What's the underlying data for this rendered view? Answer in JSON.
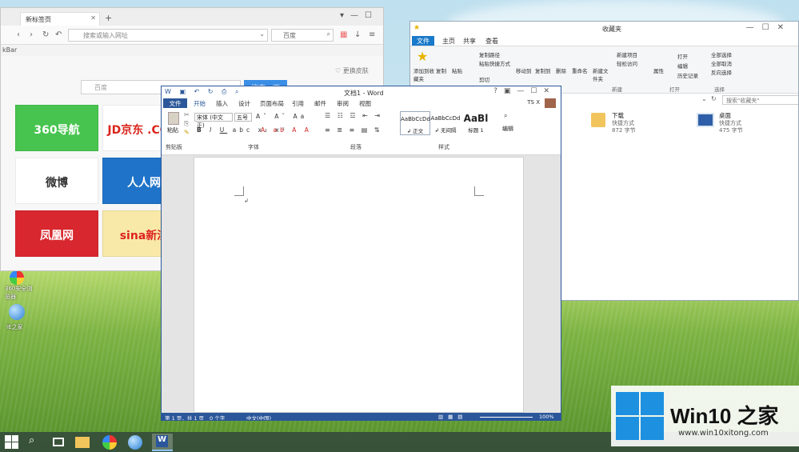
{
  "browser": {
    "tab_title": "新标签页",
    "url_placeholder": "搜索或输入网址",
    "search_engine": "百度",
    "bookmark_label": "kBar",
    "change_skin": "更换皮肤",
    "search_input": "百度",
    "search_button": "搜索一下",
    "tiles": [
      {
        "label": "360导航",
        "color": "#47c44f"
      },
      {
        "label": "JD京东 .COM",
        "color": "#ffffff"
      },
      {
        "label": "微博",
        "color": "#ffffff"
      },
      {
        "label": "人人网",
        "color": "#1f73c8"
      },
      {
        "label": "凤凰网",
        "color": "#d8272e"
      },
      {
        "label": "sina新浪",
        "color": "#f8e9a8"
      }
    ]
  },
  "explorer": {
    "title": "收藏夹",
    "tabs": [
      "文件",
      "主页",
      "共享",
      "查看"
    ],
    "ribbon": {
      "pin": "添加到收藏夹",
      "copy": "复制",
      "paste": "粘贴",
      "copy_path": "复制路径",
      "paste_shortcut": "粘贴快捷方式",
      "cut": "剪切",
      "move_to": "移动到",
      "copy_to": "复制到",
      "delete": "删除",
      "rename": "重命名",
      "new_folder": "新建文件夹",
      "new_item": "新建项目",
      "easy_access": "轻松访问",
      "properties": "属性",
      "open": "打开",
      "edit": "编辑",
      "history": "历史记录",
      "select_all": "全部选择",
      "select_none": "全部取消",
      "invert": "反向选择",
      "group_new": "新建",
      "group_open": "打开",
      "group_select": "选择"
    },
    "search_placeholder": "搜索\"收藏夹\"",
    "items": [
      {
        "name": "下载",
        "type": "快捷方式",
        "size": "872 字节"
      },
      {
        "name": "桌面",
        "type": "快捷方式",
        "size": "475 字节"
      }
    ]
  },
  "word": {
    "title": "文档1 - Word",
    "tabs": [
      "文件",
      "开始",
      "插入",
      "设计",
      "页面布局",
      "引用",
      "邮件",
      "审阅",
      "视图"
    ],
    "user": "TS X",
    "font_name": "宋体 (中文正)",
    "font_size": "五号",
    "groups": {
      "clipboard": "剪贴板",
      "font": "字体",
      "paragraph": "段落",
      "styles": "样式",
      "editing": "编辑"
    },
    "paste_label": "粘贴",
    "styles": [
      {
        "sample": "AaBbCcDd",
        "name": "↲ 正文"
      },
      {
        "sample": "AaBbCcDd",
        "name": "↲ 无间隔"
      },
      {
        "sample": "AaBl",
        "name": "标题 1"
      }
    ],
    "status": {
      "page": "第 1 页，共 1 页",
      "words": "0 个字",
      "lang": "中文(中国)",
      "zoom": "100%"
    }
  },
  "desktop": {
    "icon1_label": "360安全浏览器",
    "icon2_label": "IE之家"
  },
  "badge": {
    "title": "Win10 之家",
    "url": "www.win10xitong.com"
  }
}
